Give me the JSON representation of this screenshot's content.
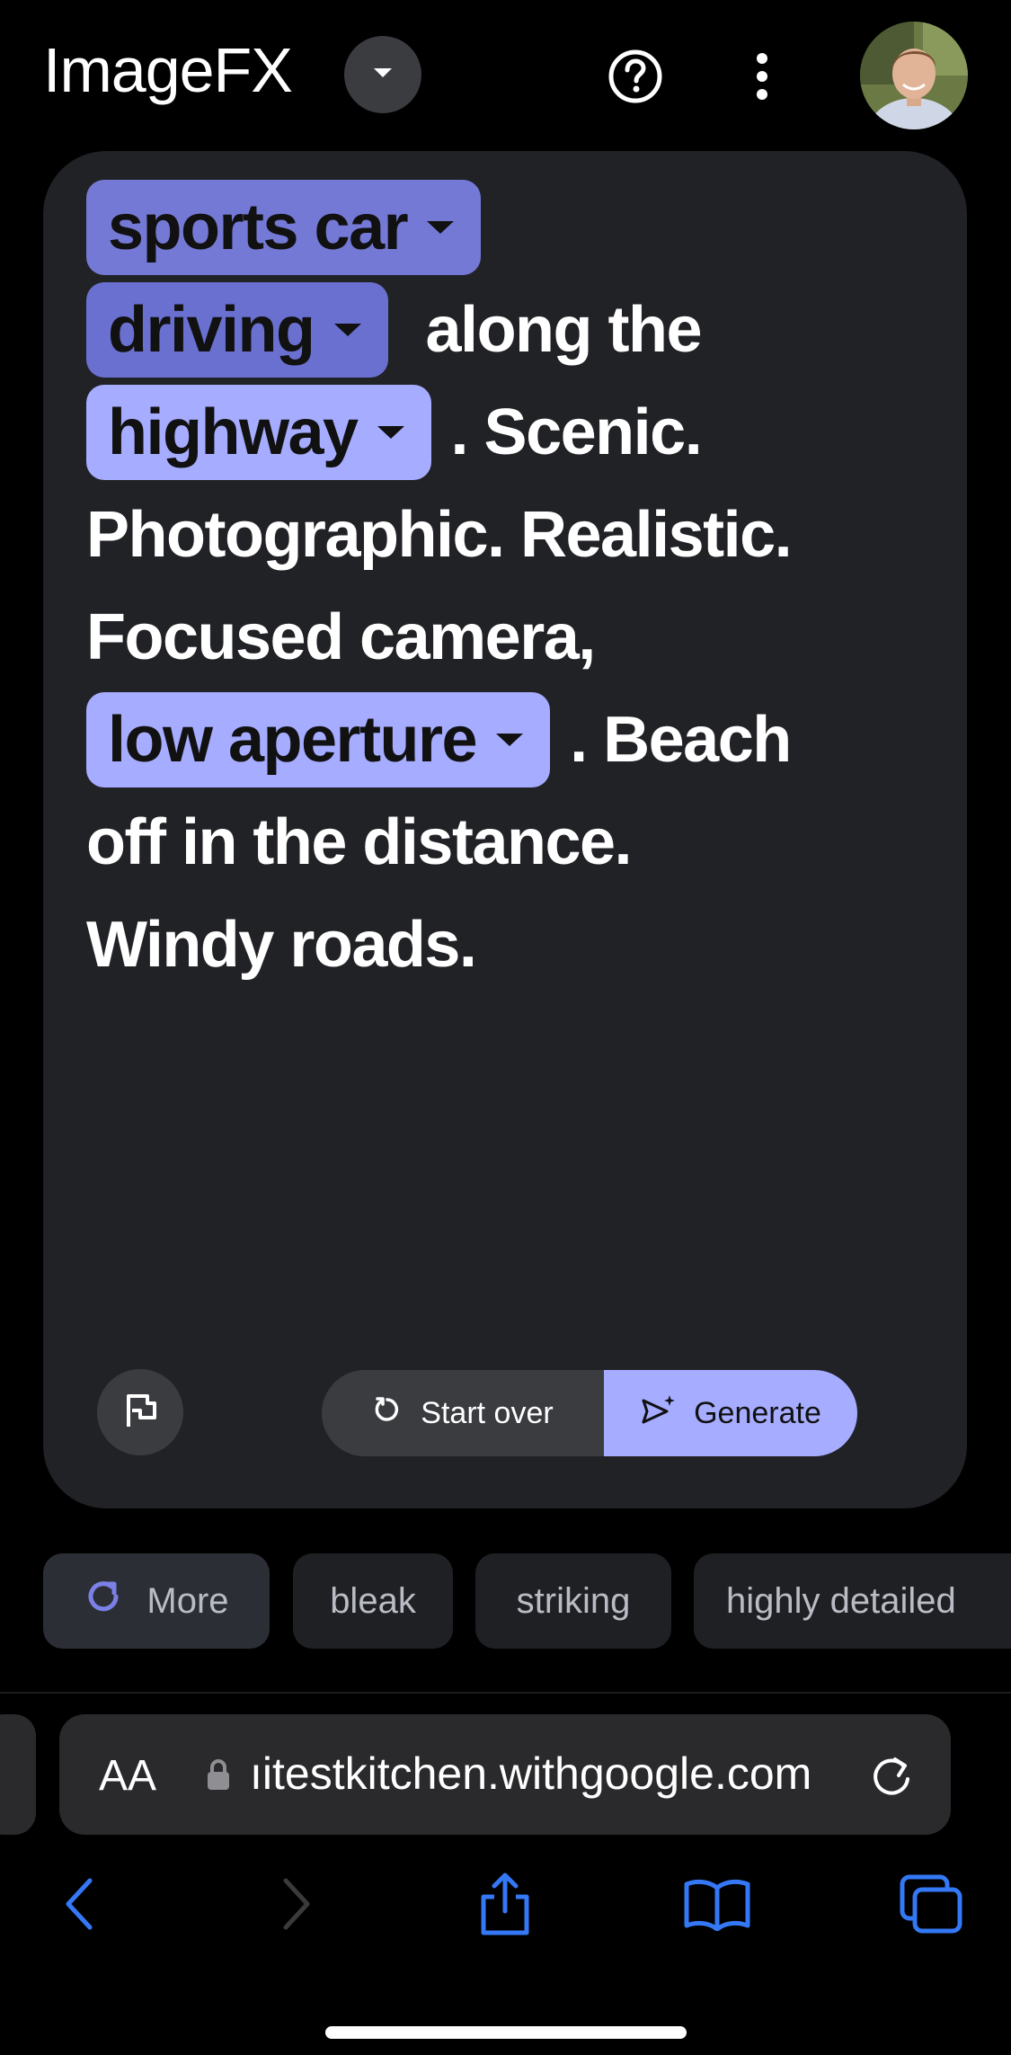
{
  "header": {
    "title": "ImageFX"
  },
  "prompt": {
    "chips": {
      "subject": "sports car",
      "action": "driving",
      "setting": "highway",
      "lens": "low aperture"
    },
    "text": {
      "along": "along the",
      "scenic": ". Scenic.",
      "line4": "Photographic. Realistic.",
      "line5": "Focused camera,",
      "beach": ". Beach",
      "line7": "off in the distance.",
      "line8": "Windy roads."
    }
  },
  "actions": {
    "start_over": "Start over",
    "generate": "Generate"
  },
  "suggestions": {
    "more": "More",
    "items": [
      "bleak",
      "striking",
      "highly detailed"
    ]
  },
  "browser": {
    "text_size": "AA",
    "url": "ıitestkitchen.withgoogle.com"
  },
  "colors": {
    "chip_dark": "#7479d6",
    "chip_light": "#a6acff",
    "card_bg": "#212226",
    "accent_blue": "#3478f6"
  }
}
